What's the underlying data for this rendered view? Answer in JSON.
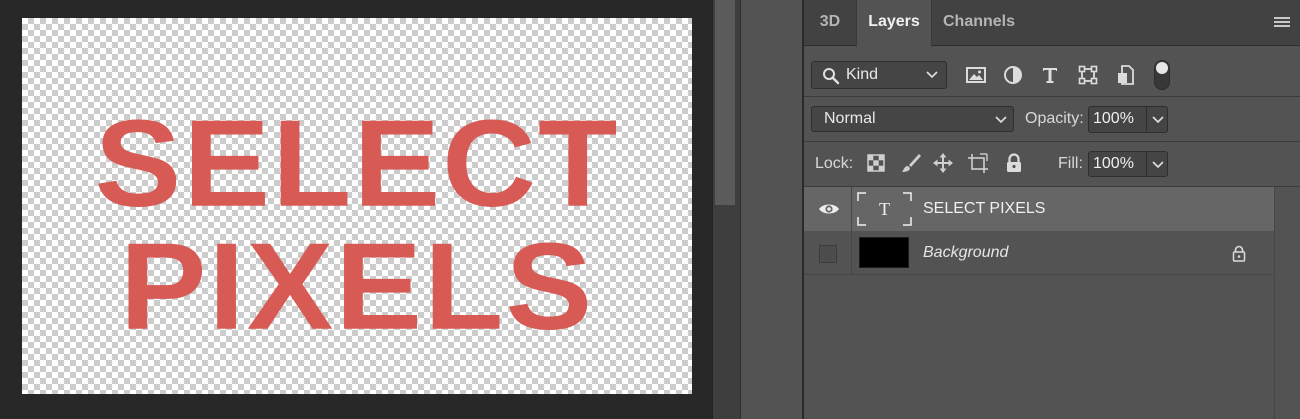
{
  "canvas": {
    "line1": "SELECT",
    "line2": "PIXELS",
    "text_color": "#d75a55"
  },
  "panel": {
    "tabs": [
      {
        "label": "3D",
        "active": false
      },
      {
        "label": "Layers",
        "active": true
      },
      {
        "label": "Channels",
        "active": false
      }
    ],
    "menu_icon": "hamburger-menu-icon"
  },
  "filter": {
    "kind_label": "Kind",
    "icons": [
      "pixel-layer-filter-icon",
      "adjustment-layer-filter-icon",
      "type-layer-filter-icon",
      "shape-layer-filter-icon",
      "smart-object-filter-icon"
    ],
    "toggle_on": true
  },
  "blend": {
    "mode": "Normal",
    "opacity_label": "Opacity:",
    "opacity_value": "100%"
  },
  "lock": {
    "label": "Lock:",
    "icons": [
      "lock-transparent-icon",
      "lock-image-icon",
      "lock-position-icon",
      "lock-artboard-icon",
      "lock-all-icon"
    ],
    "fill_label": "Fill:",
    "fill_value": "100%"
  },
  "layers": [
    {
      "name": "SELECT PIXELS",
      "type": "text",
      "visible": true,
      "selected": true,
      "thumb_glyph": "T"
    },
    {
      "name": "Background",
      "type": "background",
      "visible": false,
      "selected": false,
      "locked": true
    }
  ]
}
